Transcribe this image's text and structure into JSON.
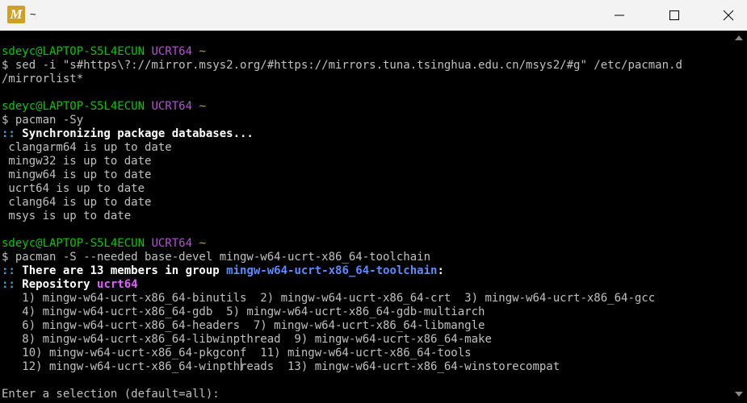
{
  "window": {
    "title": "~",
    "icon_letter": "M"
  },
  "colors": {
    "prompt_user": "#10c010",
    "prompt_env": "#b650d6",
    "prompt_dir": "#c8a800",
    "info_marker": "#2fa6d8",
    "repo_highlight": "#e060ff",
    "group_highlight": "#5b8cff"
  },
  "terminal": {
    "block1": {
      "user": "sdeyc@LAPTOP-S5L4ECUN",
      "env": "UCRT64",
      "dir": "~",
      "cmd_line1": "$ sed -i \"s#https\\?://mirror.msys2.org/#https://mirrors.tuna.tsinghua.edu.cn/msys2/#g\" /etc/pacman.d",
      "cmd_line2": "/mirrorlist*"
    },
    "block2": {
      "user": "sdeyc@LAPTOP-S5L4ECUN",
      "env": "UCRT64",
      "dir": "~",
      "cmd": "$ pacman -Sy",
      "sync_marker": "::",
      "sync_text": " Synchronizing package databases...",
      "dbs": [
        " clangarm64 is up to date",
        " mingw32 is up to date",
        " mingw64 is up to date",
        " ucrt64 is up to date",
        " clang64 is up to date",
        " msys is up to date"
      ]
    },
    "block3": {
      "user": "sdeyc@LAPTOP-S5L4ECUN",
      "env": "UCRT64",
      "dir": "~",
      "cmd": "$ pacman -S --needed base-devel mingw-w64-ucrt-x86_64-toolchain",
      "members_marker": "::",
      "members_text": " There are 13 members in group ",
      "group_name": "mingw-w64-ucrt-x86_64-toolchain",
      "members_colon": ":",
      "repo_marker": "::",
      "repo_text": " Repository ",
      "repo_name": "ucrt64",
      "packages": [
        "   1) mingw-w64-ucrt-x86_64-binutils  2) mingw-w64-ucrt-x86_64-crt  3) mingw-w64-ucrt-x86_64-gcc",
        "   4) mingw-w64-ucrt-x86_64-gdb  5) mingw-w64-ucrt-x86_64-gdb-multiarch",
        "   6) mingw-w64-ucrt-x86_64-headers  7) mingw-w64-ucrt-x86_64-libmangle",
        "   8) mingw-w64-ucrt-x86_64-libwinpthread  9) mingw-w64-ucrt-x86_64-make",
        "   10) mingw-w64-ucrt-x86_64-pkgconf  11) mingw-w64-ucrt-x86_64-tools",
        "   12) mingw-w64-ucrt-x86_64-winpthreads  13) mingw-w64-ucrt-x86_64-winstorecompat"
      ],
      "selection_prompt": "Enter a selection (default=all): "
    }
  }
}
